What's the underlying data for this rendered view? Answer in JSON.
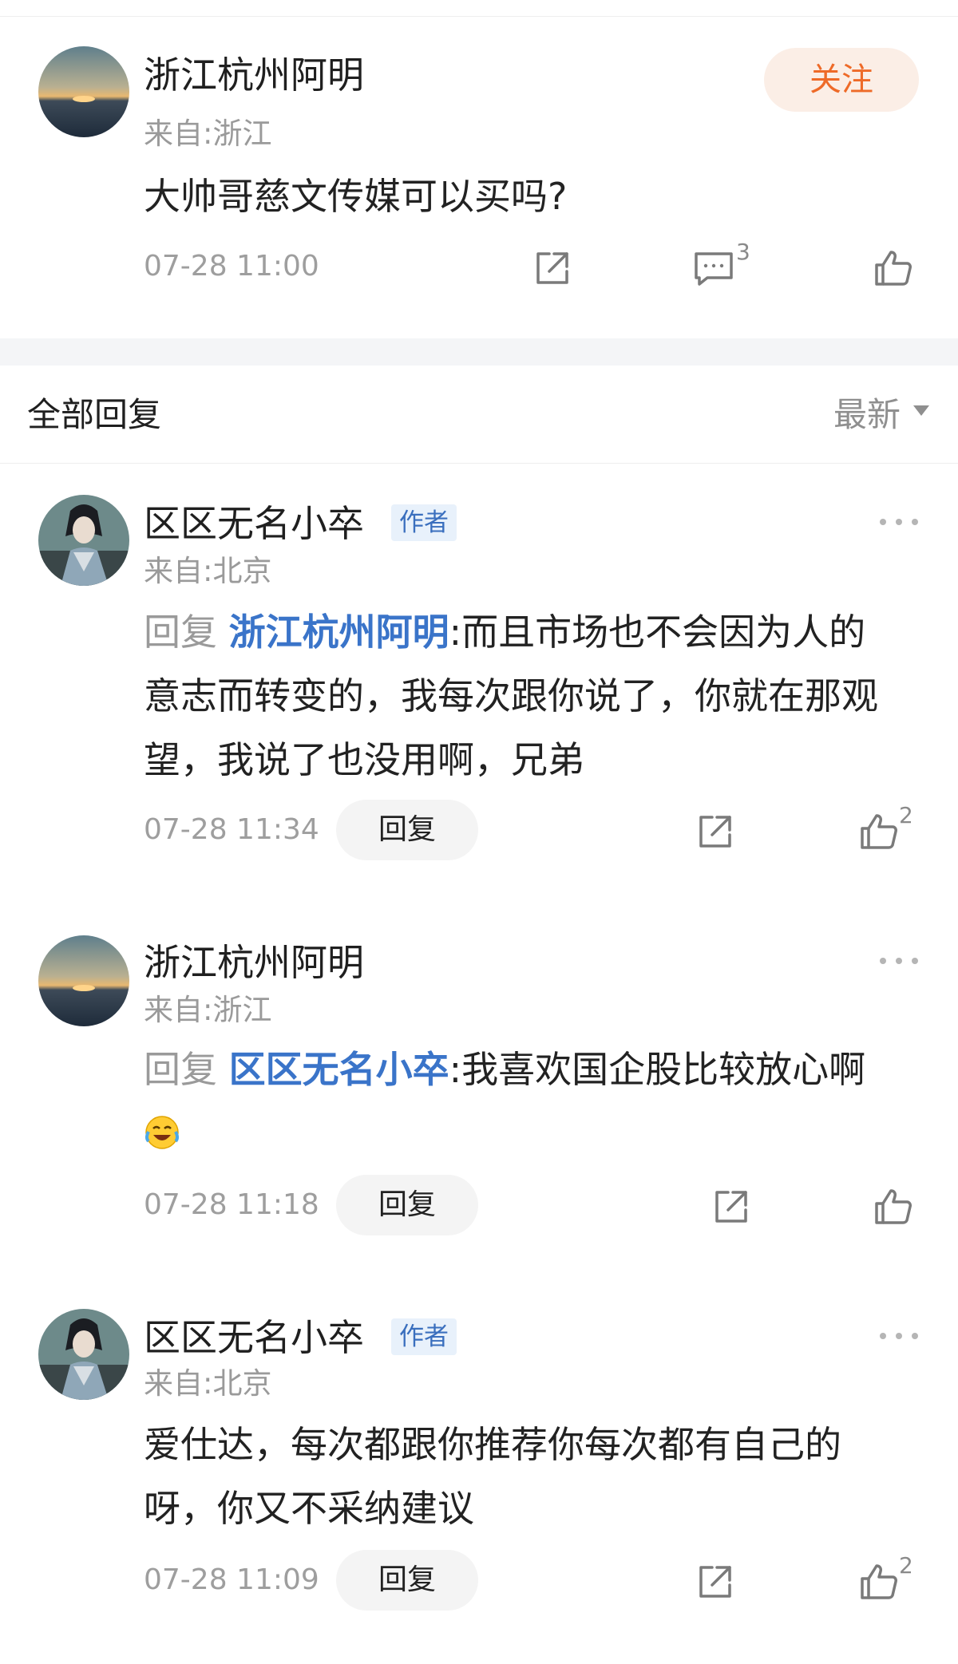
{
  "post": {
    "username": "浙江杭州阿明",
    "location": "来自:浙江",
    "follow_label": "关注",
    "text": "大帅哥慈文传媒可以买吗?",
    "time": "07-28 11:00",
    "comment_count": "3",
    "icons": [
      "share-icon",
      "comment-icon",
      "like-icon"
    ]
  },
  "replies_header": {
    "title": "全部回复",
    "sort_label": "最新"
  },
  "reply_button_label": "回复",
  "replies": [
    {
      "username": "区区无名小卒",
      "badge": "作者",
      "location": "来自:北京",
      "reply_prefix": "回复",
      "mention": "浙江杭州阿明",
      "separator": ":",
      "text": "而且市场也不会因为人的意志而转变的，我每次跟你说了，你就在那观望，我说了也没用啊，兄弟",
      "time": "07-28 11:34",
      "like_count": "2"
    },
    {
      "username": "浙江杭州阿明",
      "location": "来自:浙江",
      "reply_prefix": "回复",
      "mention": "区区无名小卒",
      "separator": ":",
      "text": "我喜欢国企股比较放心啊",
      "emoji": "laughing-tears-emoji",
      "time": "07-28 11:18"
    },
    {
      "username": "区区无名小卒",
      "badge": "作者",
      "location": "来自:北京",
      "text": "爱仕达，每次都跟你推荐你每次都有自己的呀，你又不采纳建议",
      "time": "07-28 11:09",
      "like_count": "2"
    }
  ]
}
